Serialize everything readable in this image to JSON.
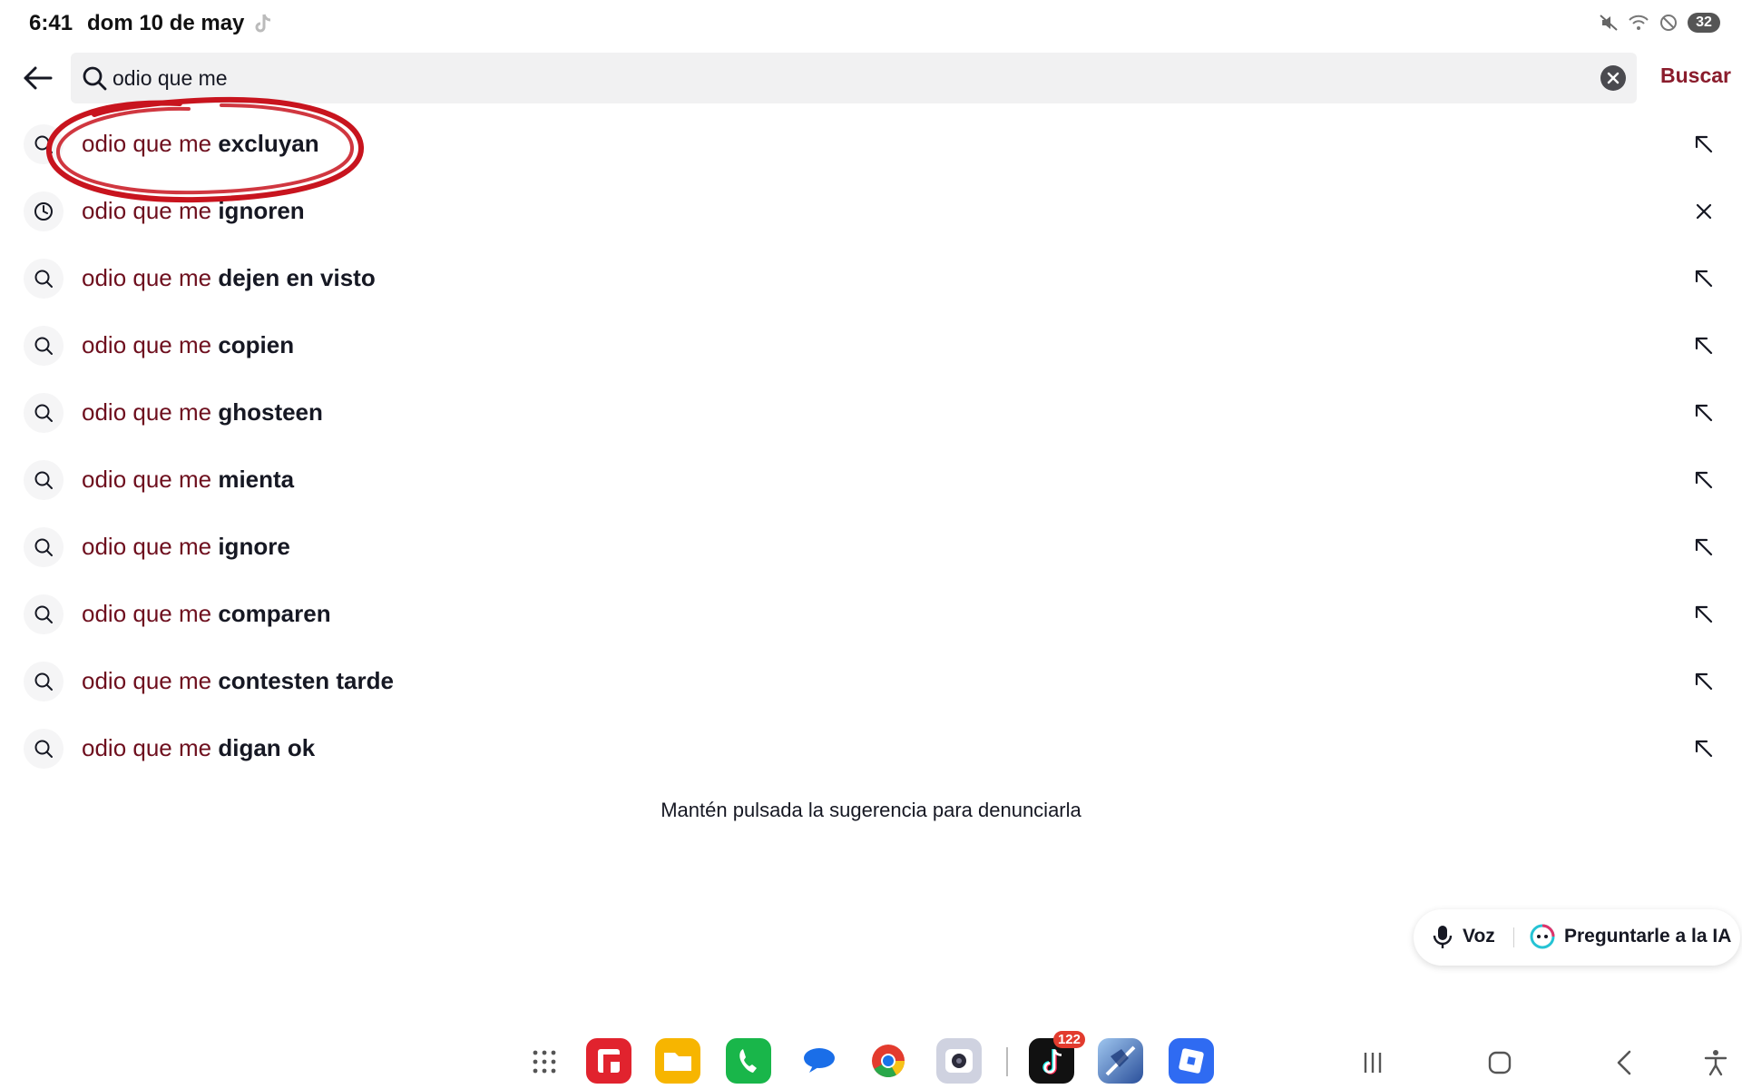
{
  "status_bar": {
    "time": "6:41",
    "date": "dom 10 de may",
    "battery": "32"
  },
  "search": {
    "query": "odio que me",
    "submit_label": "Buscar"
  },
  "suggestions": [
    {
      "prefix": "odio que me",
      "rest": " excluyan",
      "icon": "search-icon",
      "action": "arrow-up-left-icon"
    },
    {
      "prefix": "odio que me",
      "rest": " ignoren",
      "icon": "history-clock-icon",
      "action": "close-icon"
    },
    {
      "prefix": "odio que me",
      "rest": " dejen en visto",
      "icon": "search-icon",
      "action": "arrow-up-left-icon"
    },
    {
      "prefix": "odio que me",
      "rest": " copien",
      "icon": "search-icon",
      "action": "arrow-up-left-icon"
    },
    {
      "prefix": "odio que me",
      "rest": " ghosteen",
      "icon": "search-icon",
      "action": "arrow-up-left-icon"
    },
    {
      "prefix": "odio que me",
      "rest": " mienta",
      "icon": "search-icon",
      "action": "arrow-up-left-icon"
    },
    {
      "prefix": "odio que me",
      "rest": " ignore",
      "icon": "search-icon",
      "action": "arrow-up-left-icon"
    },
    {
      "prefix": "odio que me",
      "rest": " comparen",
      "icon": "search-icon",
      "action": "arrow-up-left-icon"
    },
    {
      "prefix": "odio que me",
      "rest": " contesten tarde",
      "icon": "search-icon",
      "action": "arrow-up-left-icon"
    },
    {
      "prefix": "odio que me",
      "rest": " digan ok",
      "icon": "search-icon",
      "action": "arrow-up-left-icon"
    }
  ],
  "hint": "Mantén pulsada la sugerencia para denunciarla",
  "pill": {
    "voice_label": "Voz",
    "ai_label": "Preguntarle a la IA"
  },
  "dock": {
    "tiktok_badge": "122"
  },
  "colors": {
    "brand": "#8a1c2c",
    "suggestion_prefix": "#6e0f1e",
    "annotation_red": "#c8141e"
  }
}
